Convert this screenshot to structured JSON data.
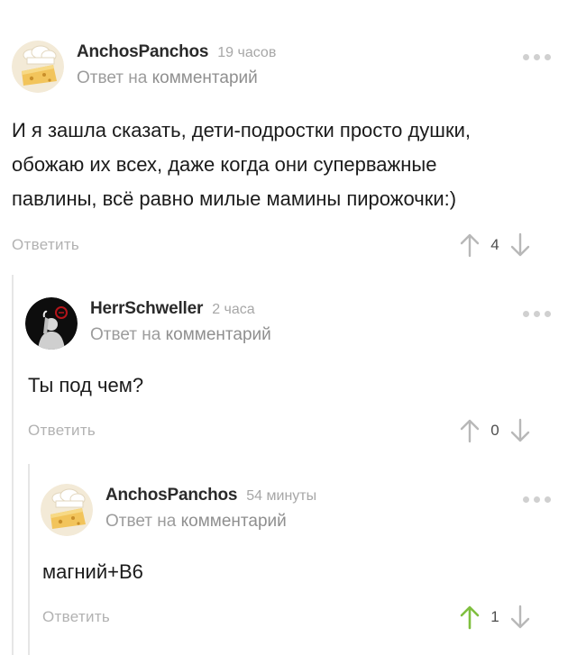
{
  "comments": [
    {
      "author": "AnchosPanchos",
      "time": "19 часов",
      "reply_prefix": "Ответ на",
      "reply_link": "комментарий",
      "text_lines": [
        "И я зашла сказать, дети-подростки просто душки,",
        "обожаю их всех, даже когда они суперважные",
        "павлины, всё равно милые мамины пирожочки:)"
      ],
      "answer_label": "Ответить",
      "score": "4",
      "avatar_icon": "chef-cheese-avatar-icon",
      "upvoted": false
    },
    {
      "author": "HerrSchweller",
      "time": "2 часа",
      "reply_prefix": "Ответ на",
      "reply_link": "комментарий",
      "text_lines": [
        "Ты под чем?"
      ],
      "answer_label": "Ответить",
      "score": "0",
      "avatar_icon": "dark-figure-avatar-icon",
      "upvoted": false
    },
    {
      "author": "AnchosPanchos",
      "time": "54 минуты",
      "reply_prefix": "Ответ на",
      "reply_link": "комментарий",
      "text_lines": [
        "магний+B6"
      ],
      "answer_label": "Ответить",
      "score": "1",
      "avatar_icon": "chef-cheese-avatar-icon",
      "upvoted": true
    }
  ],
  "colors": {
    "upvote_active": "#7fbf3f",
    "arrow_inactive": "#b8b8b8",
    "thread_line": "#e6e6e6"
  }
}
